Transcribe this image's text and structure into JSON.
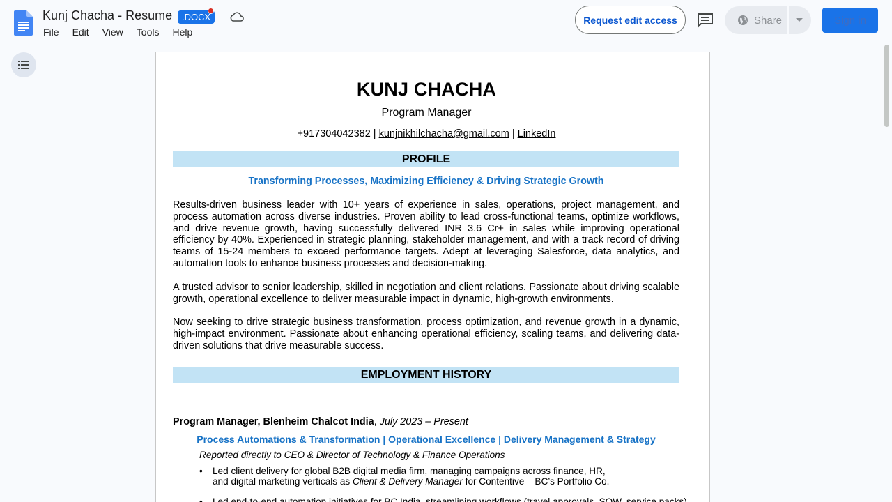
{
  "header": {
    "doc_title": "Kunj Chacha - Resume",
    "badge": ".DOCX",
    "menu": [
      "File",
      "Edit",
      "View",
      "Tools",
      "Help"
    ],
    "request_edit_label": "Request edit access",
    "share_label": "Share",
    "signin_label": "Sign in"
  },
  "icons": {
    "docs_logo": "google-docs-icon",
    "cloud": "cloud-saved-icon",
    "comments": "comment-icon",
    "globe": "globe-icon",
    "outline": "document-outline-icon"
  },
  "colors": {
    "accent": "#1a73e8",
    "section_bar": "#c2e3f5",
    "tagline": "#1873c6"
  },
  "resume": {
    "name": "KUNJ CHACHA",
    "role": "Program Manager",
    "phone": "+917304042382",
    "separator": " | ",
    "email": "kunjnikhilchacha@gmail.com",
    "linkedin": "LinkedIn",
    "profile_heading": "PROFILE",
    "profile_tagline": "Transforming Processes, Maximizing Efficiency & Driving Strategic Growth",
    "profile_paragraphs": [
      "Results-driven business leader with 10+ years of experience in sales, operations, project management, and process automation across diverse industries. Proven ability to lead cross-functional teams, optimize workflows, and drive revenue growth, having successfully delivered INR 3.6 Cr+ in sales while improving operational efficiency by 40%. Experienced in strategic planning, stakeholder management, and with a track record of driving teams of 15-24 members to exceed performance targets. Adept at leveraging Salesforce, data analytics, and automation tools to enhance business processes and decision-making.",
      "A trusted advisor to senior leadership, skilled in negotiation and client relations. Passionate about driving scalable growth, operational excellence to deliver measurable impact in dynamic, high-growth environments.",
      "Now seeking to drive strategic business transformation, process optimization, and revenue growth in a dynamic, high-impact environment. Passionate about enhancing operational efficiency, scaling teams, and delivering data-driven solutions that drive measurable success."
    ],
    "employment_heading": "EMPLOYMENT HISTORY",
    "job": {
      "title": "Program Manager, Blenheim Chalcot India",
      "comma": ", ",
      "dates": "July 2023 – Present",
      "tags": "Process Automations & Transformation | Operational Excellence | Delivery Management & Strategy",
      "reported": "Reported directly to CEO & Director of Technology & Finance Operations",
      "bullet1_a": "Led client delivery for global B2B digital media firm, managing campaigns across finance, HR,",
      "bullet1_b": "and digital marketing verticals as ",
      "bullet1_role": "Client & Delivery Manager",
      "bullet1_c": " for Contentive – BC’s Portfolio Co.",
      "bullet2": "Led end-to-end automation initiatives for BC India, streamlining workflows (travel approvals, SOW, service packs)",
      "bullet_symbol": "•"
    }
  }
}
